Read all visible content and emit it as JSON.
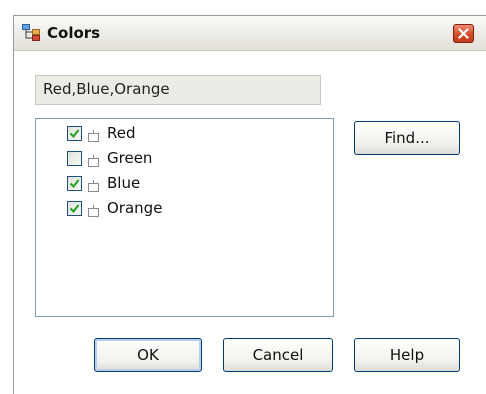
{
  "window": {
    "title": "Colors",
    "icon": "app-tree-icon",
    "close_icon": "close-icon"
  },
  "summary": {
    "value": "Red,Blue,Orange"
  },
  "list": {
    "items": [
      {
        "label": "Red",
        "checked": true
      },
      {
        "label": "Green",
        "checked": false
      },
      {
        "label": "Blue",
        "checked": true
      },
      {
        "label": "Orange",
        "checked": true
      }
    ]
  },
  "buttons": {
    "find": "Find...",
    "ok": "OK",
    "cancel": "Cancel",
    "help": "Help"
  },
  "colors": {
    "check_green": "#21a121",
    "close_red": "#d94a28",
    "border_blue": "#003c74"
  }
}
